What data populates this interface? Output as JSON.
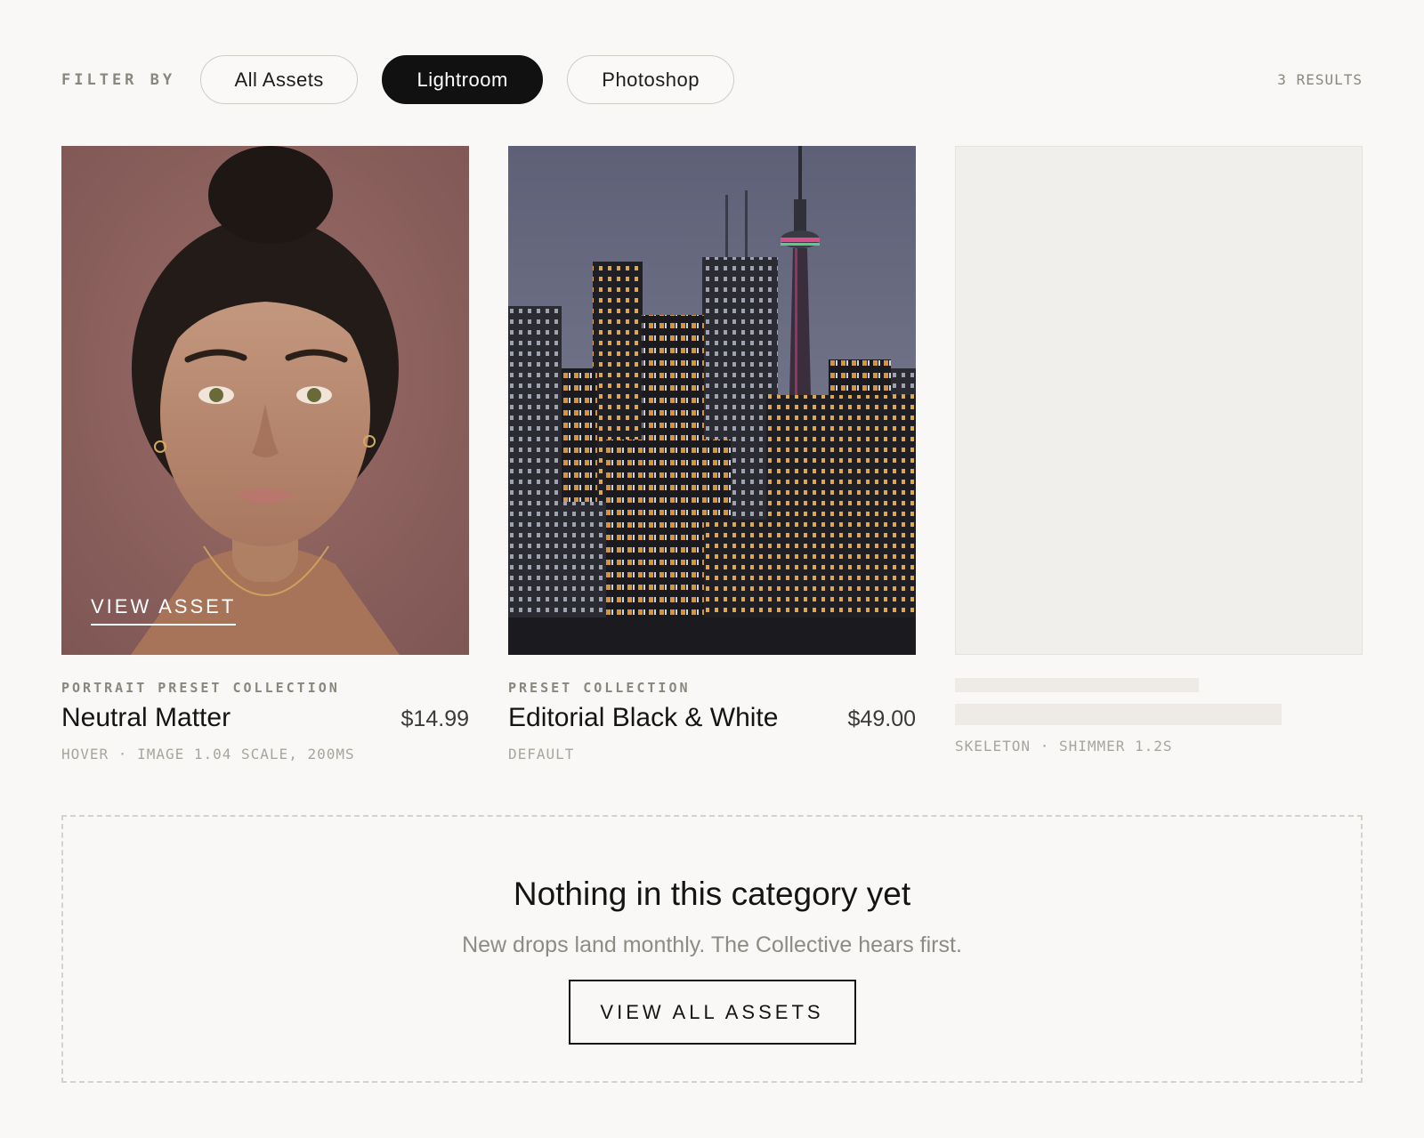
{
  "filter": {
    "label": "FILTER BY",
    "options": [
      "All Assets",
      "Lightroom",
      "Photoshop"
    ],
    "selected": "Lightroom",
    "results": "3 RESULTS"
  },
  "cards": [
    {
      "eyebrow": "PORTRAIT PRESET COLLECTION",
      "title": "Neutral Matter",
      "price": "$14.99",
      "meta": "HOVER · IMAGE 1.04 SCALE, 200MS",
      "overlay": "VIEW ASSET",
      "image": "portrait-photo"
    },
    {
      "eyebrow": "PRESET COLLECTION",
      "title": "Editorial Black & White",
      "price": "$49.00",
      "meta": "DEFAULT",
      "image": "city-skyline-photo"
    },
    {
      "meta": "SKELETON · SHIMMER 1.2S",
      "image": "skeleton-placeholder"
    }
  ],
  "empty_state": {
    "title": "Nothing in this category yet",
    "subtitle": "New drops land monthly. The Collective hears first.",
    "button": "VIEW ALL ASSETS"
  },
  "colors": {
    "background": "#f9f8f6",
    "active_pill": "#111111",
    "muted_text": "#8a877f",
    "skeleton": "#f1efeb",
    "portrait_backdrop": "#8f6461"
  }
}
